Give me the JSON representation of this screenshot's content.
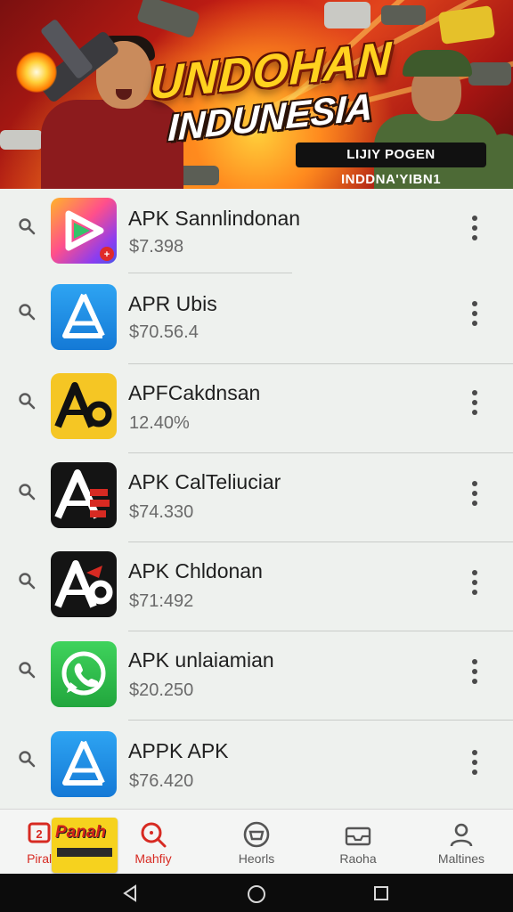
{
  "banner": {
    "title": "UNDOHAN",
    "subtitle": "INDUNESIA",
    "tag": "LIJIY POGEN INDDNA'YIBN1"
  },
  "apps": [
    {
      "name": "APK Sannlindonan",
      "price": "$7.398",
      "icon": "play-triangle-icon"
    },
    {
      "name": "APR Ubis",
      "price": "$70.56.4",
      "icon": "app-store-a-icon"
    },
    {
      "name": "APFCakdnsan",
      "price": "12.40%",
      "icon": "ao-letter-icon"
    },
    {
      "name": "APK CalTeliuciar",
      "price": "$74.330",
      "icon": "red-a-letter-icon"
    },
    {
      "name": "APK Chldonan",
      "price": "$71:492",
      "icon": "ao-letter-icon"
    },
    {
      "name": "APK unlaiamian",
      "price": "$20.250",
      "icon": "whatsapp-icon"
    },
    {
      "name": "APPK APK",
      "price": "$76.420",
      "icon": "app-store-a-icon"
    }
  ],
  "bottom_nav": {
    "items": [
      {
        "label": "Pirale",
        "icon": "calendar-badge-icon",
        "active": true
      },
      {
        "label": "Mahfiy",
        "icon": "search-icon",
        "active": true
      },
      {
        "label": "Heorls",
        "icon": "controller-circle-icon",
        "active": false
      },
      {
        "label": "Raoha",
        "icon": "tray-icon",
        "active": false
      },
      {
        "label": "Maltines",
        "icon": "person-icon",
        "active": false
      }
    ],
    "promo_text": "Panah"
  },
  "colors": {
    "accent_red": "#d72a22",
    "app_blue": "#1e8fe6",
    "whatsapp_green": "#2fb94a",
    "ao_yellow": "#f5c624"
  }
}
